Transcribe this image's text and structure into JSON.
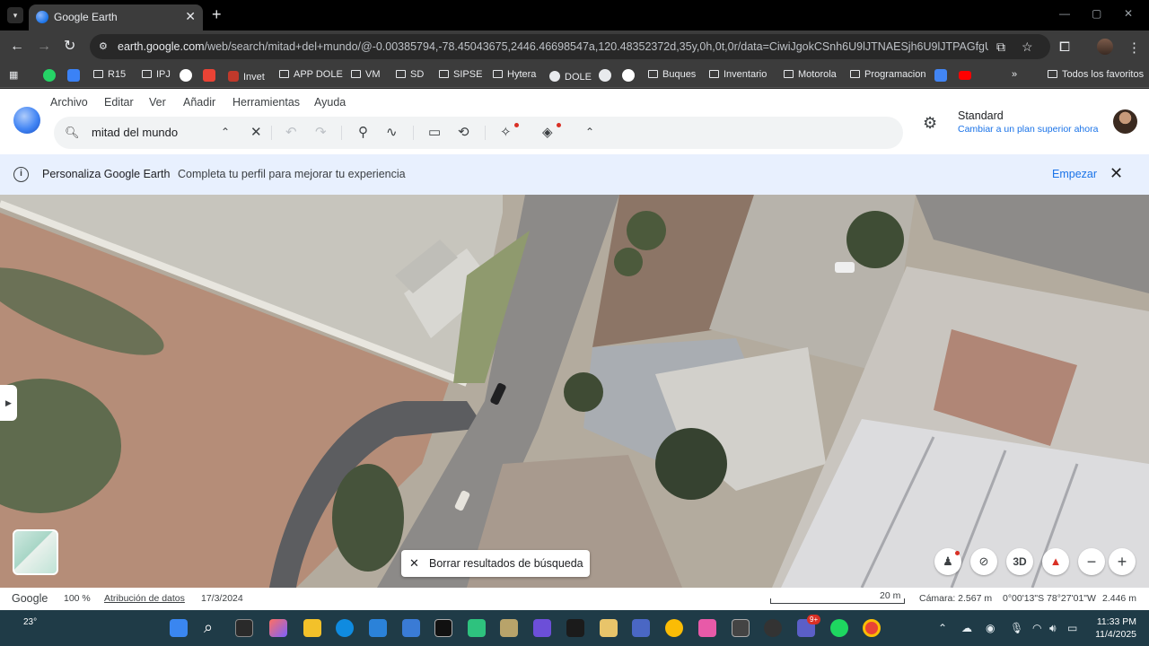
{
  "browser": {
    "tab_title": "Google Earth",
    "url_host": "earth.google.com",
    "url_path": "/web/search/mitad+del+mundo/@-0.00385794,-78.45043675,2446.46698547a,120.48352372d,35y,0h,0t,0r/data=CiwiJgokCSnh6U9lJTNAESjh6U9lJTPAGfgUaYK5ckdAlen...",
    "bookmarks": [
      "R15",
      "IPJ",
      "Invet",
      "APP DOLE",
      "VM",
      "SD",
      "SIPSE",
      "Hytera",
      "DOLE",
      "Buques",
      "Inventario",
      "Motorola",
      "Programacion"
    ],
    "bookmarks_overflow": "»",
    "all_bookmarks": "Todos los favoritos"
  },
  "app": {
    "menu": [
      "Archivo",
      "Editar",
      "Ver",
      "Añadir",
      "Herramientas",
      "Ayuda"
    ],
    "search_value": "mitad del mundo",
    "plan_title": "Standard",
    "plan_link": "Cambiar a un plan superior ahora"
  },
  "banner": {
    "title": "Personaliza Google Earth",
    "text": "Completa tu perfil para mejorar tu experiencia",
    "cta": "Empezar"
  },
  "map": {
    "clear_label": "Borrar resultados de búsqueda",
    "btn_3d": "3D"
  },
  "status": {
    "logo": "Google",
    "zoom": "100 %",
    "attribution": "Atribución de datos",
    "date": "17/3/2024",
    "scale": "20 m",
    "camera": "Cámara: 2.567 m",
    "coords": "0°00'13\"S 78°27'01\"W",
    "elevation": "2.446 m"
  },
  "taskbar": {
    "temperature": "23°",
    "time": "11:33 PM",
    "date": "11/4/2025",
    "badge": "9+"
  },
  "colors": {
    "accent": "#1a73e8",
    "banner_bg": "#e8f0fe",
    "taskbar_bg": "#1f3b47"
  }
}
